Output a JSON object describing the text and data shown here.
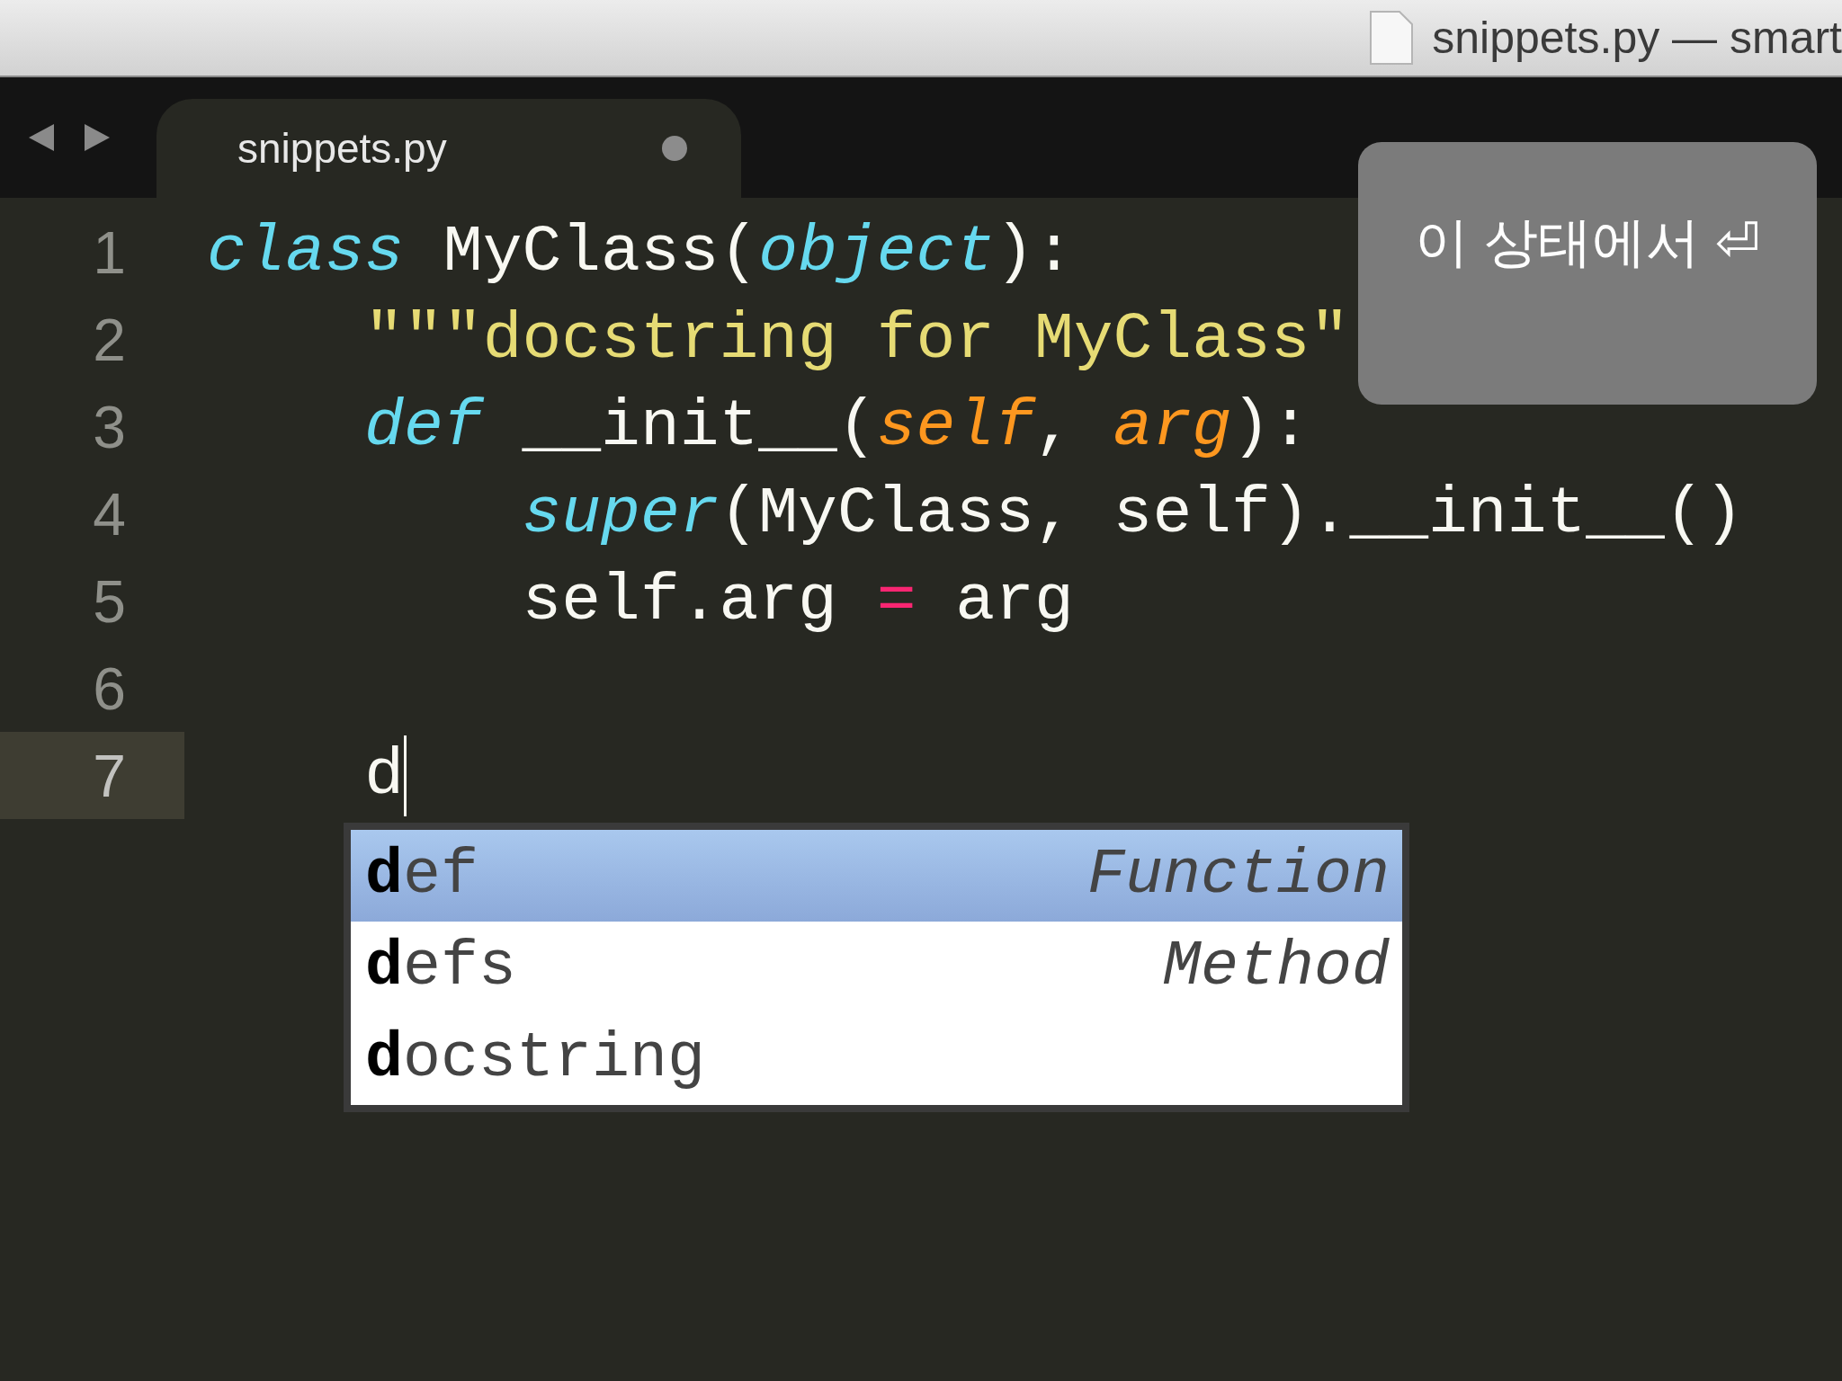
{
  "window": {
    "title": "snippets.py — smart"
  },
  "tabs": [
    {
      "label": "snippets.py",
      "selected": true,
      "modified": true
    }
  ],
  "code_lines": [
    {
      "number": "1",
      "current": false,
      "tokens": [
        {
          "kind": "keyword",
          "text": "class"
        },
        {
          "kind": "plain",
          "text": " MyClass("
        },
        {
          "kind": "builtin",
          "text": "object"
        },
        {
          "kind": "plain",
          "text": "):"
        }
      ]
    },
    {
      "number": "2",
      "current": false,
      "tokens": [
        {
          "kind": "string",
          "text": "    \"\"\"docstring for MyClass\""
        }
      ]
    },
    {
      "number": "3",
      "current": false,
      "tokens": [
        {
          "kind": "keyword",
          "text": "    def"
        },
        {
          "kind": "plain",
          "text": " __init__("
        },
        {
          "kind": "param",
          "text": "self"
        },
        {
          "kind": "plain",
          "text": ", "
        },
        {
          "kind": "param",
          "text": "arg"
        },
        {
          "kind": "plain",
          "text": "):"
        }
      ]
    },
    {
      "number": "4",
      "current": false,
      "tokens": [
        {
          "kind": "builtin",
          "text": "        super"
        },
        {
          "kind": "plain",
          "text": "(MyClass, self).__init__()"
        }
      ]
    },
    {
      "number": "5",
      "current": false,
      "tokens": [
        {
          "kind": "plain",
          "text": "        self.arg "
        },
        {
          "kind": "operator",
          "text": "="
        },
        {
          "kind": "plain",
          "text": " arg"
        }
      ]
    },
    {
      "number": "6",
      "current": false
    },
    {
      "number": "7",
      "current": true,
      "tokens": [
        {
          "kind": "plain",
          "text": "    d"
        }
      ]
    }
  ],
  "completions": [
    {
      "label": "**d**ef",
      "type": "Function",
      "selected": true
    },
    {
      "label": "**d**efs",
      "type": "Method",
      "selected": false
    },
    {
      "label": "**d**ocstring",
      "selected": false
    }
  ],
  "overlay": {
    "text": "이 상태에서 ⏎"
  }
}
